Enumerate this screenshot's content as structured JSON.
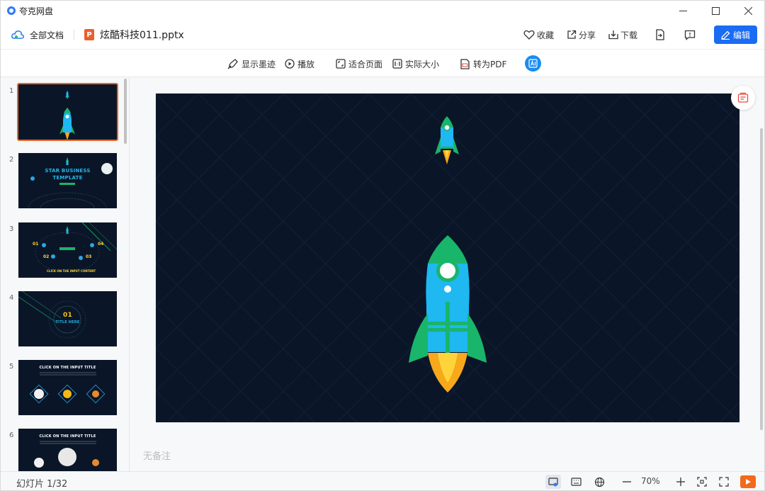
{
  "window": {
    "title": "夸克网盘",
    "controls": [
      "minimize-icon",
      "maximize-icon",
      "close-icon"
    ]
  },
  "header": {
    "all_docs": "全部文档",
    "file_name": "炫酷科技011.pptx",
    "file_badge": "P",
    "favorite": "收藏",
    "share": "分享",
    "download": "下载",
    "edit": "编辑"
  },
  "toolbar": {
    "ink": "显示墨迹",
    "play": "播放",
    "fit_page": "适合页面",
    "actual_size": "实际大小",
    "to_pdf": "转为PDF"
  },
  "thumbnails": [
    {
      "num": "1",
      "selected": true
    },
    {
      "num": "2",
      "title_line1": "STAR BUSINESS",
      "title_line2": "TEMPLATE"
    },
    {
      "num": "3",
      "labels": [
        "01",
        "02",
        "03",
        "04"
      ],
      "footer": "CLICK ON THE INPUT CONTENT"
    },
    {
      "num": "4",
      "big": "01",
      "sub": "TITLE HERE"
    },
    {
      "num": "5",
      "title": "CLICK ON THE INPUT TITLE"
    },
    {
      "num": "6",
      "title": "CLICK ON THE INPUT TITLE"
    }
  ],
  "notes_placeholder": "无备注",
  "status": {
    "slide_counter": "幻灯片 1/32",
    "zoom": "70%"
  },
  "colors": {
    "accent": "#1a6cf3",
    "slide_bg": "#0a1628",
    "rocket_blue": "#1fb8f0",
    "rocket_green": "#19b56a",
    "flame": "#f7a81b",
    "selected_border": "#e8672c"
  }
}
